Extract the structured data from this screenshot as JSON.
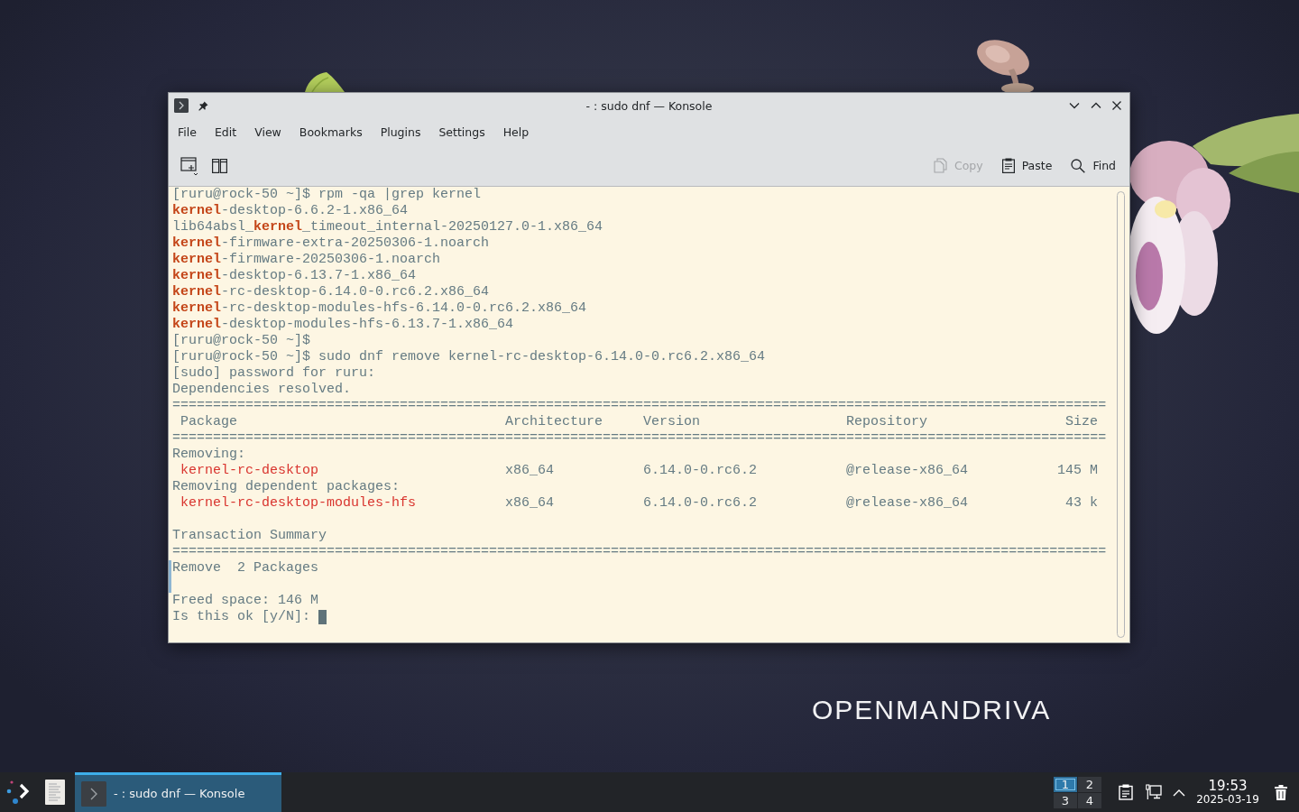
{
  "window": {
    "title": "- : sudo dnf — Konsole"
  },
  "menu": [
    "File",
    "Edit",
    "View",
    "Bookmarks",
    "Plugins",
    "Settings",
    "Help"
  ],
  "toolbar": {
    "actions": [
      {
        "label": "Copy",
        "disabled": true
      },
      {
        "label": "Paste",
        "disabled": false
      },
      {
        "label": "Find",
        "disabled": false
      }
    ]
  },
  "terminal": {
    "lines": [
      {
        "kind": "text",
        "text": "[ruru@rock-50 ~]$ rpm -qa |grep kernel",
        "marked": false
      },
      {
        "kind": "text",
        "text": "**kernel**-desktop-6.6.2-1.x86_64",
        "marked": false
      },
      {
        "kind": "text",
        "text": "lib64absl_**kernel**_timeout_internal-20250127.0-1.x86_64",
        "marked": false
      },
      {
        "kind": "text",
        "text": "**kernel**-firmware-extra-20250306-1.noarch",
        "marked": false
      },
      {
        "kind": "text",
        "text": "**kernel**-firmware-20250306-1.noarch",
        "marked": false
      },
      {
        "kind": "text",
        "text": "**kernel**-desktop-6.13.7-1.x86_64",
        "marked": false
      },
      {
        "kind": "text",
        "text": "**kernel**-rc-desktop-6.14.0-0.rc6.2.x86_64",
        "marked": false
      },
      {
        "kind": "text",
        "text": "**kernel**-rc-desktop-modules-hfs-6.14.0-0.rc6.2.x86_64",
        "marked": false
      },
      {
        "kind": "text",
        "text": "**kernel**-desktop-modules-hfs-6.13.7-1.x86_64",
        "marked": false
      },
      {
        "kind": "text",
        "text": "[ruru@rock-50 ~]$",
        "marked": false
      },
      {
        "kind": "text",
        "text": "[ruru@rock-50 ~]$ sudo dnf remove kernel-rc-desktop-6.14.0-0.rc6.2.x86_64",
        "marked": false
      },
      {
        "kind": "text",
        "text": "[sudo] password for ruru:",
        "marked": false
      },
      {
        "kind": "text",
        "text": "Dependencies resolved.",
        "marked": false
      },
      {
        "kind": "rule",
        "text": "===================================================================================================================",
        "marked": false
      },
      {
        "kind": "header",
        "cells": [
          "Package",
          "Architecture",
          "Version",
          "Repository",
          "Size"
        ],
        "marked": false
      },
      {
        "kind": "rule",
        "text": "===================================================================================================================",
        "marked": false
      },
      {
        "kind": "text",
        "text": "Removing:",
        "marked": false
      },
      {
        "kind": "row",
        "cells": [
          "kernel-rc-desktop",
          "x86_64",
          "6.14.0-0.rc6.2",
          "@release-x86_64",
          "145 M"
        ],
        "marked": false
      },
      {
        "kind": "text",
        "text": "Removing dependent packages:",
        "marked": false
      },
      {
        "kind": "row",
        "cells": [
          "kernel-rc-desktop-modules-hfs",
          "x86_64",
          "6.14.0-0.rc6.2",
          "@release-x86_64",
          "43 k"
        ],
        "marked": false
      },
      {
        "kind": "blank",
        "marked": false
      },
      {
        "kind": "text",
        "text": "Transaction Summary",
        "marked": false
      },
      {
        "kind": "rule",
        "text": "===================================================================================================================",
        "marked": false
      },
      {
        "kind": "text",
        "text": "Remove  2 Packages",
        "marked": true
      },
      {
        "kind": "blank",
        "marked": true
      },
      {
        "kind": "text",
        "text": "Freed space: 146 M",
        "marked": false
      },
      {
        "kind": "prompt",
        "text": "Is this ok [y/N]:",
        "marked": false
      }
    ]
  },
  "desktop": {
    "logo": "OPENMANDRIVA"
  },
  "taskbar": {
    "task": {
      "title": "- : sudo dnf — Konsole",
      "selected": true
    },
    "pager": [
      {
        "label": "1",
        "selected": true
      },
      {
        "label": "2",
        "selected": false
      },
      {
        "label": "3",
        "selected": false
      },
      {
        "label": "4",
        "selected": false
      }
    ],
    "clock": {
      "time": "19:53",
      "date": "2025-03-19"
    }
  }
}
